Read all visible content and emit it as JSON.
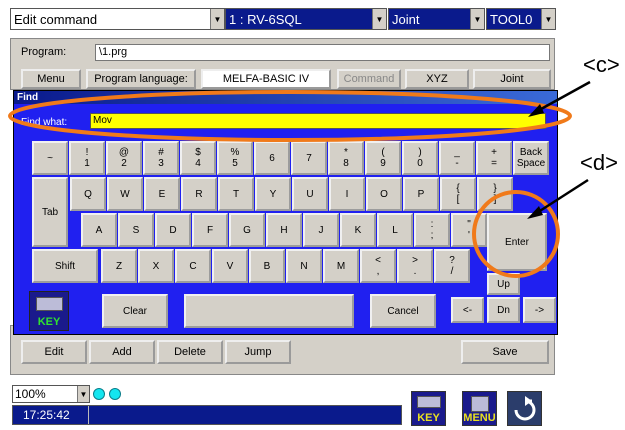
{
  "header": {
    "mode_dropdown": "Edit command",
    "robot_dropdown": "1 : RV-6SQL",
    "coord_dropdown": "Joint",
    "tool_dropdown": "TOOL0"
  },
  "program": {
    "label": "Program:",
    "value": "\\1.prg"
  },
  "background_buttons": {
    "menu": "Menu",
    "language_label": "Program language:",
    "language_value": "MELFA-BASIC IV",
    "command": "Command",
    "xyz": "XYZ",
    "joint": "Joint",
    "edit": "Edit",
    "add": "Add",
    "delete": "Delete",
    "jump": "Jump",
    "save": "Save"
  },
  "find_dialog": {
    "title": "Find",
    "find_what_label": "Find what:",
    "find_what_value": "Mov"
  },
  "keyboard": {
    "row1": [
      {
        "top": "",
        "main": "~",
        "name": "key-tilde"
      },
      {
        "top": "!",
        "main": "1",
        "name": "key-1"
      },
      {
        "top": "@",
        "main": "2",
        "name": "key-2"
      },
      {
        "top": "#",
        "main": "3",
        "name": "key-3"
      },
      {
        "top": "$",
        "main": "4",
        "name": "key-4"
      },
      {
        "top": "%",
        "main": "5",
        "name": "key-5"
      },
      {
        "top": "",
        "main": "6",
        "name": "key-6"
      },
      {
        "top": "",
        "main": "7",
        "name": "key-7"
      },
      {
        "top": "*",
        "main": "8",
        "name": "key-8"
      },
      {
        "top": "(",
        "main": "9",
        "name": "key-9"
      },
      {
        "top": ")",
        "main": "0",
        "name": "key-0"
      },
      {
        "top": "_",
        "main": "-",
        "name": "key-minus"
      },
      {
        "top": "+",
        "main": "=",
        "name": "key-equals"
      },
      {
        "top": "Back",
        "main": "Space",
        "name": "key-backspace"
      }
    ],
    "row2": [
      "Q",
      "W",
      "E",
      "R",
      "T",
      "Y",
      "U",
      "I",
      "O",
      "P"
    ],
    "row2_brackets": [
      {
        "top": "{",
        "main": "["
      },
      {
        "top": "}",
        "main": "]"
      }
    ],
    "row3": [
      "A",
      "S",
      "D",
      "F",
      "G",
      "H",
      "J",
      "K",
      "L"
    ],
    "row3_punct": [
      {
        "top": ":",
        "main": ";"
      },
      {
        "top": "\"",
        "main": "'"
      }
    ],
    "row4": [
      "Z",
      "X",
      "C",
      "V",
      "B",
      "N",
      "M"
    ],
    "row4_punct": [
      {
        "top": "<",
        "main": ","
      },
      {
        "top": ">",
        "main": "."
      },
      {
        "top": "?",
        "main": "/"
      }
    ],
    "tab": "Tab",
    "shift": "Shift",
    "enter": "Enter",
    "up": "Up",
    "dn": "Dn",
    "left": "<-",
    "right": "->",
    "clear": "Clear",
    "cancel": "Cancel",
    "key_logo": "KEY"
  },
  "footer": {
    "zoom": "100%",
    "time": "17:25:42",
    "key_tile": "KEY",
    "menu_tile": "MENU"
  },
  "annotations": {
    "c": "<c>",
    "d": "<d>"
  },
  "colors": {
    "dialog_bg": "#2020f0",
    "input_highlight": "#ffff00",
    "annotation": "#f07a1a",
    "status_bar": "#0a1a8c"
  }
}
